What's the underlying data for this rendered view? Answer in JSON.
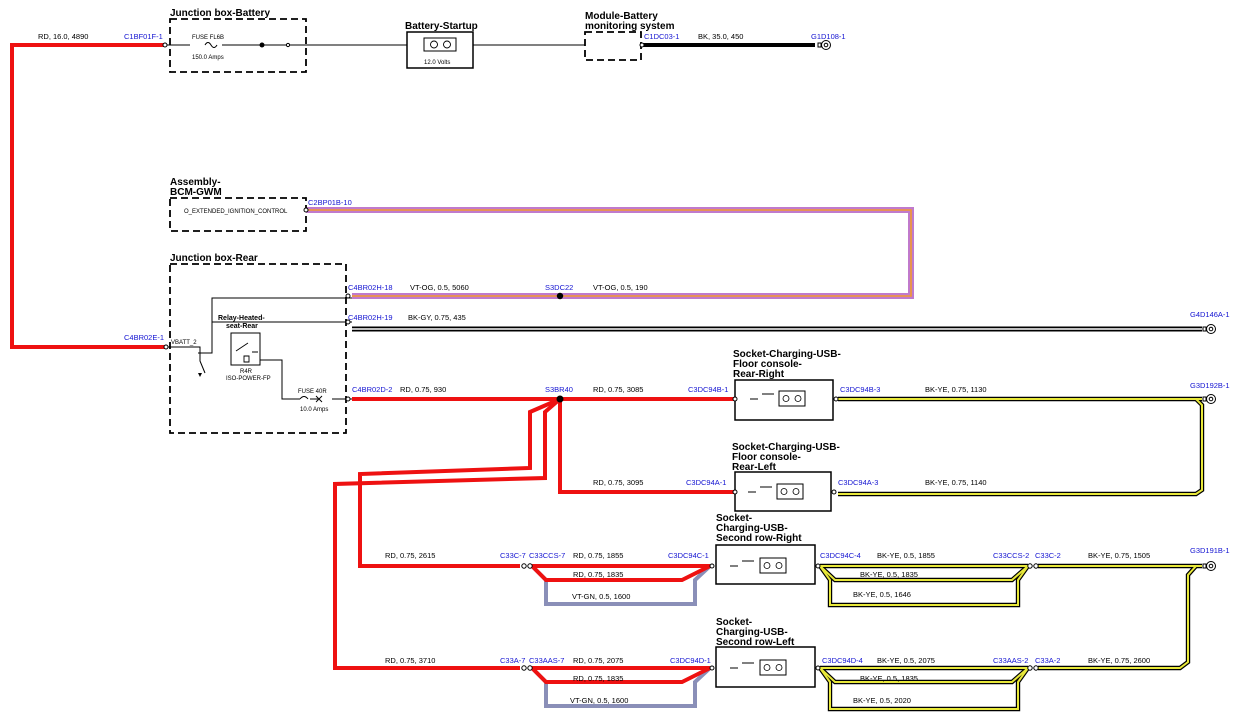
{
  "components": {
    "jb_battery": {
      "title": "Junction box-Battery",
      "fuse_name": "FUSE FL6B",
      "fuse_rating": "150.0 Amps"
    },
    "battery": {
      "title": "Battery-Startup",
      "rating": "12.0 Volts"
    },
    "bms": {
      "title_1": "Module-Battery",
      "title_2": "monitoring system"
    },
    "bcm": {
      "title_1": "Assembly-",
      "title_2": "BCM-GWM",
      "signal": "O_EXTENDED_IGNITION_CONTROL"
    },
    "jb_rear": {
      "title": "Junction box-Rear",
      "pin_label": "VBATT_2",
      "relay_1": "Relay-Heated-",
      "relay_2": "seat-Rear",
      "relay_code_1": "R4R",
      "relay_code_2": "ISO-POWER-FP",
      "fuse_name": "FUSE 40R",
      "fuse_rating": "10.0 Amps"
    },
    "usb_rr": {
      "t1": "Socket-Charging-USB-",
      "t2": "Floor console-",
      "t3": "Rear-Right"
    },
    "usb_rl": {
      "t1": "Socket-Charging-USB-",
      "t2": "Floor console-",
      "t3": "Rear-Left"
    },
    "usb_2r": {
      "t1": "Socket-",
      "t2": "Charging-USB-",
      "t3": "Second row-Right"
    },
    "usb_2l": {
      "t1": "Socket-",
      "t2": "Charging-USB-",
      "t3": "Second row-Left"
    }
  },
  "connectors": {
    "c1bf01f": "C1BF01F-1",
    "c1dc03": "C1DC03-1",
    "g1d108": "G1D108-1",
    "c2bp01b": "C2BP01B-10",
    "c4br02h18": "C4BR02H-18",
    "s3dc22": "S3DC22",
    "c4br02h19": "C4BR02H-19",
    "g4d146a": "G4D146A-1",
    "c4br02e": "C4BR02E-1",
    "c4br02d": "C4BR02D-2",
    "s3br40": "S3BR40",
    "c3dc94b1": "C3DC94B-1",
    "c3dc94b3": "C3DC94B-3",
    "g3d192b": "G3D192B-1",
    "c3dc94a1": "C3DC94A-1",
    "c3dc94a3": "C3DC94A-3",
    "c33c7": "C33C-7",
    "c33ccs7": "C33CCS-7",
    "c3dc94c1": "C3DC94C-1",
    "c3dc94c4": "C3DC94C-4",
    "c33ccs2": "C33CCS-2",
    "c33c2": "C33C-2",
    "g3d191b": "G3D191B-1",
    "c33a7": "C33A-7",
    "c33aas7": "C33AAS-7",
    "c3dc94d1": "C3DC94D-1",
    "c3dc94d4": "C3DC94D-4",
    "c33aas2": "C33AAS-2",
    "c33a2": "C33A-2"
  },
  "wires": {
    "w_bat_in": "RD,  16.0,  4890",
    "w_bms_gnd": "BK,  35.0,  450",
    "w_vtog_1": "VT-OG,  0.5,  5060",
    "w_vtog_2": "VT-OG,  0.5,  190",
    "w_bkgy": "BK-GY,  0.75,  435",
    "w_rd_930": "RD,  0.75,  930",
    "w_rd_3085": "RD,  0.75,  3085",
    "w_bkye_1130": "BK-YE,  0.75,  1130",
    "w_rd_3095": "RD,  0.75,  3095",
    "w_bkye_1140": "BK-YE,  0.75,  1140",
    "w_rd_2615": "RD,  0.75,  2615",
    "w_rd_1855": "RD,  0.75,  1855",
    "w_rd_1835a": "RD,  0.75,  1835",
    "w_vtgn_1600a": "VT-GN,  0.5,  1600",
    "w_bkye_1855": "BK-YE,  0.5,  1855",
    "w_bkye_1835a": "BK-YE,  0.5,  1835",
    "w_bkye_1646": "BK-YE,  0.5,  1646",
    "w_bkye_1505": "BK-YE,  0.75,  1505",
    "w_rd_3710": "RD,  0.75,  3710",
    "w_rd_2075": "RD,  0.75,  2075",
    "w_rd_1835b": "RD,  0.75,  1835",
    "w_vtgn_1600b": "VT-GN,  0.5,  1600",
    "w_bkye_2075": "BK-YE,  0.5,  2075",
    "w_bkye_1835b": "BK-YE,  0.5,  1835",
    "w_bkye_2020": "BK-YE,  0.5,  2020",
    "w_bkye_2600": "BK-YE,  0.75,  2600"
  },
  "colors": {
    "red": "#ee1111",
    "yellow": "#e8e83a",
    "violet": "#c07acc",
    "orange": "#f29a2e",
    "grey": "#9a9a9a",
    "black": "#000000",
    "blue_label": "#1414d2"
  }
}
